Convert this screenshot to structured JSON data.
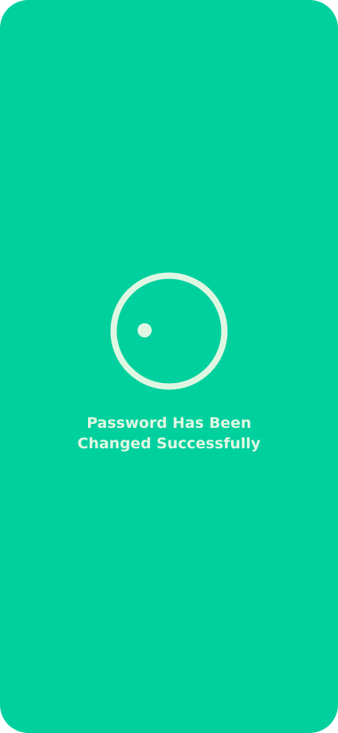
{
  "screen": {
    "background_color": "#00D09E",
    "accent_color": "#DFF7E2"
  },
  "loader": {
    "icon": "loading-spinner-icon"
  },
  "message": {
    "line1": "Password Has Been",
    "line2": "Changed Successfully"
  }
}
